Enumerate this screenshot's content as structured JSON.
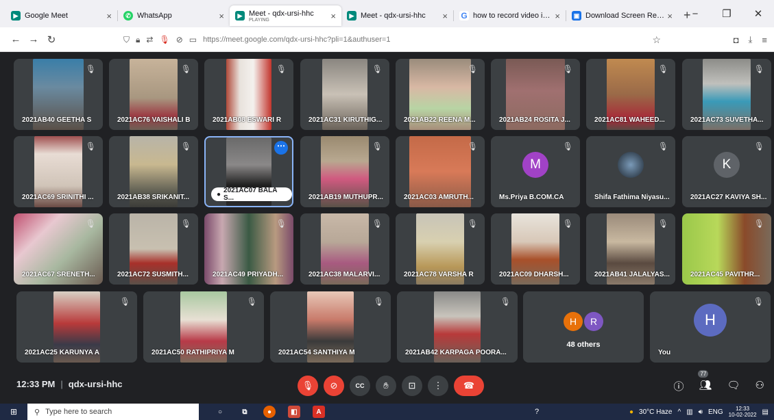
{
  "browser": {
    "tabs": [
      {
        "title": "Google Meet",
        "icon": "meet-icon",
        "color": "#00897b",
        "active": false
      },
      {
        "title": "WhatsApp",
        "icon": "whatsapp-icon",
        "color": "#25d366",
        "active": false
      },
      {
        "title": "Meet - qdx-ursi-hhc",
        "sub": "PLAYING",
        "icon": "meet-icon",
        "color": "#00897b",
        "active": true
      },
      {
        "title": "Meet - qdx-ursi-hhc",
        "icon": "meet-icon",
        "color": "#00897b",
        "active": false
      },
      {
        "title": "how to record video in google",
        "icon": "google-icon",
        "color": "#4285f4",
        "active": false
      },
      {
        "title": "Download Screen Recorder AP",
        "icon": "recorder-icon",
        "color": "#1a73e8",
        "active": false
      }
    ],
    "url": "https://meet.google.com/qdx-ursi-hhc?pli=1&authuser=1"
  },
  "meeting": {
    "time": "12:33 PM",
    "code": "qdx-ursi-hhc",
    "participant_badge": "77"
  },
  "participants_row1": [
    "2021AB40 GEETHA S",
    "2021AC76 VAISHALI B",
    "2021AB08 ESWARI R",
    "2021AC31 KIRUTHIG...",
    "2021AB22 REENA M...",
    "2021AB24 ROSITA J...",
    "2021AC81 WAHEED...",
    "2021AC73 SUVETHA..."
  ],
  "participants_row2": [
    "2021AC69 SRINITHI ...",
    "2021AB38 SRIKANIT...",
    "2021AC07 BALA S...",
    "2021AB19 MUTHUPR...",
    "2021AC03 AMRUTH...",
    "Ms.Priya B.COM.CA",
    "Shifa Fathima Niyasu...",
    "2021AC27 KAVIYA SH..."
  ],
  "participants_row3": [
    "2021AC67 SRENETH...",
    "2021AC72 SUSMITH...",
    "2021AC49 PRIYADH...",
    "2021AC38 MALARVI...",
    "2021AC78 VARSHA R",
    "2021AC09 DHARSH...",
    "2021AB41 JALALYAS...",
    "2021AC45 PAVITHR..."
  ],
  "participants_row4": [
    "2021AC25 KARUNYA A",
    "2021AC50 RATHIPRIYA M",
    "2021AC54 SANTHIYA M",
    "2021AB42 KARPAGA POORA..."
  ],
  "avatars": {
    "priya": {
      "letter": "M",
      "color": "#a142c6"
    },
    "kaviya": {
      "letter": "K",
      "color": "#5f6368"
    },
    "you": {
      "letter": "H",
      "color": "#5c6bc0"
    }
  },
  "others": {
    "label": "48 others",
    "a1": "H",
    "a2": "R",
    "c1": "#e8710a",
    "c2": "#7e57c2"
  },
  "you_label": "You",
  "taskbar": {
    "search_placeholder": "Type here to search",
    "weather": "30°C Haze",
    "lang": "ENG",
    "time": "12:33",
    "date": "10-02-2022"
  }
}
